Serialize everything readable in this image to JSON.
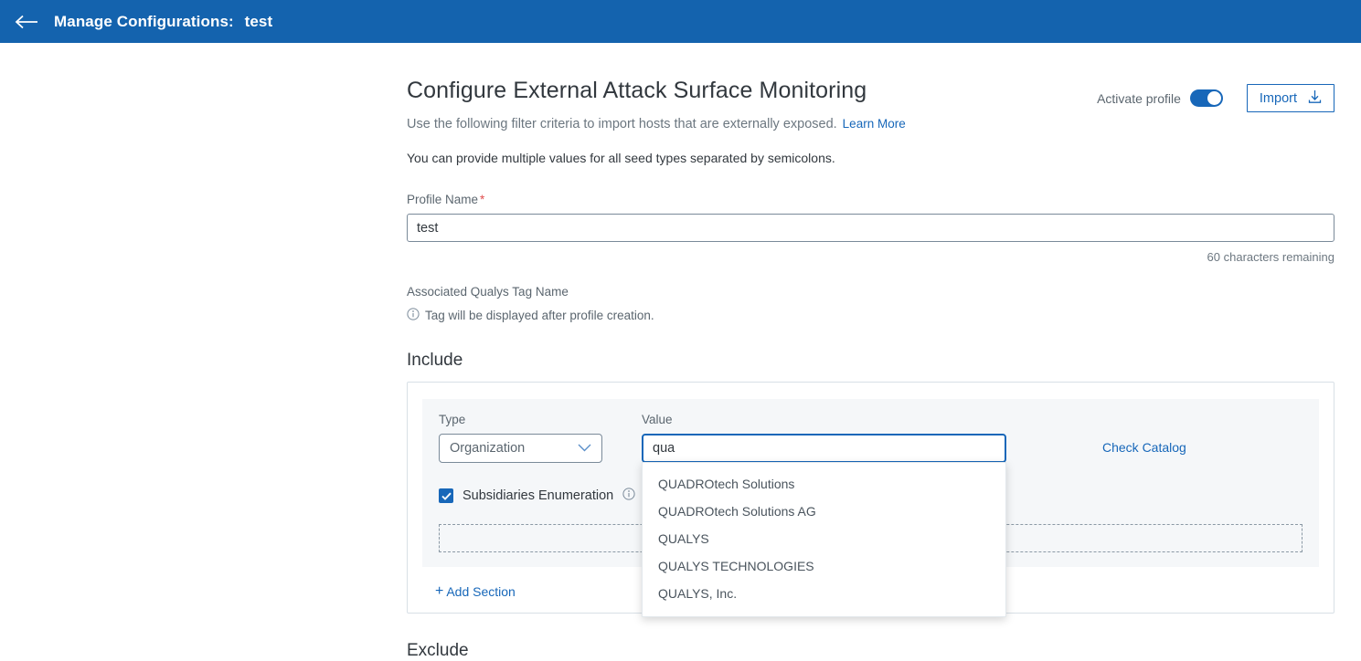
{
  "topbar": {
    "back_icon": "arrow-left-icon",
    "label": "Manage Configurations:",
    "profile_name": "test",
    "background_color": "#1463ae"
  },
  "header": {
    "title": "Configure External Attack Surface Monitoring",
    "subtitle": "Use the following filter criteria to import hosts that are externally exposed.",
    "learn_more": "Learn More",
    "note": "You can provide multiple values for all seed types separated by semicolons."
  },
  "controls": {
    "activate_label": "Activate profile",
    "activate_state": "on",
    "import_label": "Import",
    "import_icon": "download-icon",
    "accent_color": "#1767b9"
  },
  "profile": {
    "label": "Profile Name",
    "required_marker": "*",
    "value": "test",
    "placeholder": "",
    "counter": "60 characters remaining"
  },
  "tag": {
    "label": "Associated Qualys Tag Name",
    "info_icon": "info-circle-icon",
    "hint": "Tag will be displayed after profile creation."
  },
  "include": {
    "heading": "Include",
    "type_label": "Type",
    "type_value": "Organization",
    "type_options": [
      "Organization"
    ],
    "value_label": "Value",
    "value_text": "qua",
    "value_placeholder": "",
    "check_catalog": "Check Catalog",
    "suggestions": [
      "QUADROtech Solutions",
      "QUADROtech Solutions AG",
      "QUALYS",
      "QUALYS TECHNOLOGIES",
      "QUALYS, Inc."
    ],
    "subsidiaries_label": "Subsidiaries Enumeration",
    "subsidiaries_checked": "checked",
    "subsidiaries_info_icon": "info-circle-icon",
    "add_section": "Add Section",
    "add_section_plus": "+"
  },
  "exclude": {
    "heading": "Exclude"
  }
}
